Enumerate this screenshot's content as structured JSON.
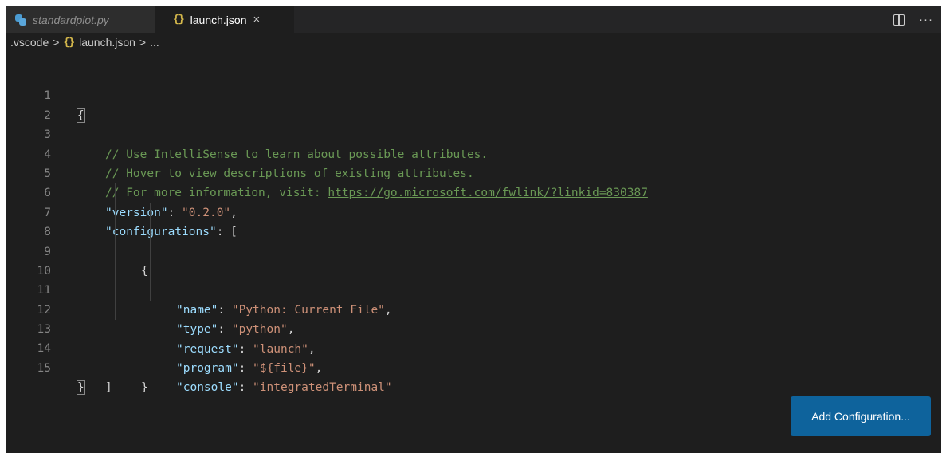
{
  "tabs": [
    {
      "label": "standardplot.py",
      "icon": "python-file-icon",
      "active": false
    },
    {
      "label": "launch.json",
      "icon": "json-file-icon",
      "icon_glyph": "{}",
      "active": true,
      "close": "×"
    }
  ],
  "tab_actions": {
    "split": "split-editor-icon",
    "more": "···"
  },
  "breadcrumb": {
    "folder": ".vscode",
    "sep": ">",
    "file_icon": "{}",
    "file": "launch.json",
    "tail": "..."
  },
  "editor": {
    "line_numbers": [
      "1",
      "2",
      "3",
      "4",
      "5",
      "6",
      "7",
      "8",
      "9",
      "10",
      "11",
      "12",
      "13",
      "14",
      "15"
    ],
    "lines": {
      "l1": "{",
      "l2": "// Use IntelliSense to learn about possible attributes.",
      "l3": "// Hover to view descriptions of existing attributes.",
      "l4_comment": "// For more information, visit: ",
      "l4_link": "https://go.microsoft.com/fwlink/?linkid=830387",
      "l5_key": "\"version\"",
      "l5_val": "\"0.2.0\"",
      "l6_key": "\"configurations\"",
      "l6_open": "[",
      "l7": "{",
      "l8_key": "\"name\"",
      "l8_val": "\"Python: Current File\"",
      "l9_key": "\"type\"",
      "l9_val": "\"python\"",
      "l10_key": "\"request\"",
      "l10_val": "\"launch\"",
      "l11_key": "\"program\"",
      "l11_val": "\"${file}\"",
      "l12_key": "\"console\"",
      "l12_val": "\"integratedTerminal\"",
      "l13": "}",
      "l14": "]",
      "l15": "}"
    }
  },
  "add_config_label": "Add Configuration...",
  "colors": {
    "background": "#1e1e1e",
    "tabbar": "#252526",
    "comment": "#6a9955",
    "key": "#9cdcfe",
    "string": "#ce9178",
    "button": "#0e639c"
  }
}
